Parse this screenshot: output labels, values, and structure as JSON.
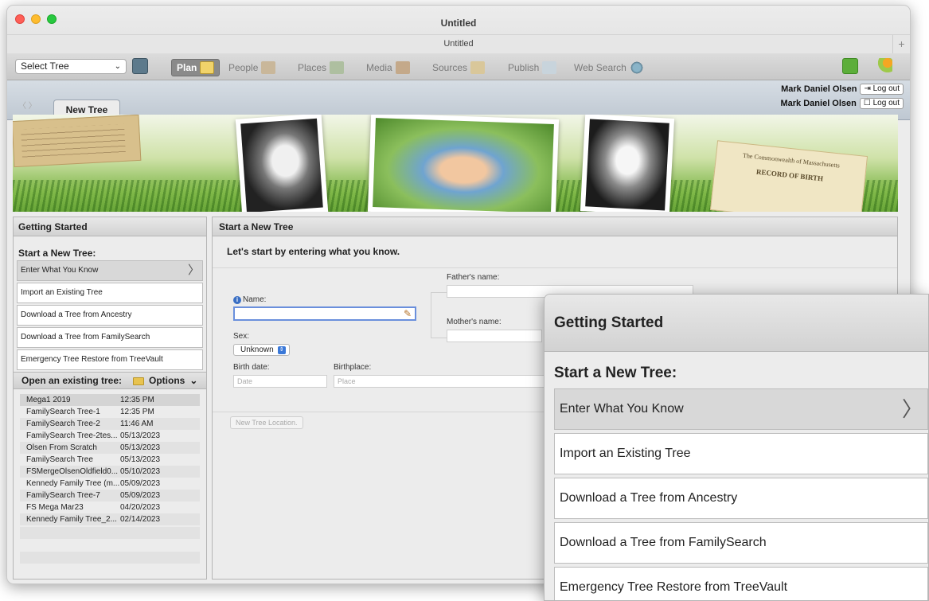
{
  "window": {
    "title": "Untitled",
    "tab_title": "Untitled",
    "plus": "+"
  },
  "toolbar": {
    "tree_select": "Select Tree",
    "buttons": [
      {
        "label": "Plan",
        "icon": "plan-notepad-icon"
      },
      {
        "label": "People",
        "icon": "people-icon"
      },
      {
        "label": "Places",
        "icon": "places-map-icon"
      },
      {
        "label": "Media",
        "icon": "media-icon"
      },
      {
        "label": "Sources",
        "icon": "sources-icon"
      },
      {
        "label": "Publish",
        "icon": "publish-icon"
      },
      {
        "label": "Web Search",
        "icon": "web-search-icon"
      }
    ]
  },
  "user": {
    "rows": [
      {
        "name": "Mark Daniel Olsen",
        "button": "Log out"
      },
      {
        "name": "Mark Daniel Olsen",
        "button": "Log out"
      }
    ]
  },
  "doc_tab": "New Tree",
  "banner": {
    "doc_right_line1": "The Commonwealth of Massachusetts",
    "doc_right_line2": "RECORD OF BIRTH"
  },
  "getting_started": {
    "header": "Getting Started",
    "section": "Start a New Tree:",
    "items": [
      "Enter What You Know",
      "Import an Existing Tree",
      "Download a Tree from Ancestry",
      "Download a Tree from FamilySearch",
      "Emergency Tree Restore from TreeVault"
    ],
    "open_header": "Open an existing tree:",
    "options_label": "Options",
    "trees": [
      {
        "name": "Mega1 2019",
        "date": "12:35 PM"
      },
      {
        "name": "FamilySearch Tree-1",
        "date": "12:35 PM"
      },
      {
        "name": "FamilySearch Tree-2",
        "date": "11:46 AM"
      },
      {
        "name": "FamilySearch Tree-2tes...",
        "date": "05/13/2023"
      },
      {
        "name": "Olsen From Scratch",
        "date": "05/13/2023"
      },
      {
        "name": "FamilySearch Tree",
        "date": "05/13/2023"
      },
      {
        "name": "FSMergeOlsenOldfield0...",
        "date": "05/10/2023"
      },
      {
        "name": "Kennedy Family Tree (m...",
        "date": "05/09/2023"
      },
      {
        "name": "FamilySearch Tree-7",
        "date": "05/09/2023"
      },
      {
        "name": "FS Mega Mar23",
        "date": "04/20/2023"
      },
      {
        "name": "Kennedy Family Tree_2...",
        "date": "02/14/2023"
      }
    ]
  },
  "new_tree": {
    "header": "Start a New Tree",
    "lead": "Let's start by entering what you know.",
    "name_label": "Name:",
    "name_value": "",
    "father_label": "Father's name:",
    "mother_label": "Mother's name:",
    "sex_label": "Sex:",
    "sex_value": "Unknown",
    "birth_date_label": "Birth date:",
    "birth_date_placeholder": "Date",
    "birthplace_label": "Birthplace:",
    "birthplace_placeholder": "Place",
    "location_button": "New Tree Location."
  },
  "zoom": {
    "header": "Getting Started",
    "section": "Start a New Tree:",
    "items": [
      "Enter What You Know",
      "Import an Existing Tree",
      "Download a Tree from Ancestry",
      "Download a Tree from FamilySearch",
      "Emergency Tree Restore from TreeVault"
    ]
  },
  "colors": {
    "active_button": "#8a8a8a",
    "name_focus": "#6a8fdc",
    "info": "#3a6fc4"
  }
}
